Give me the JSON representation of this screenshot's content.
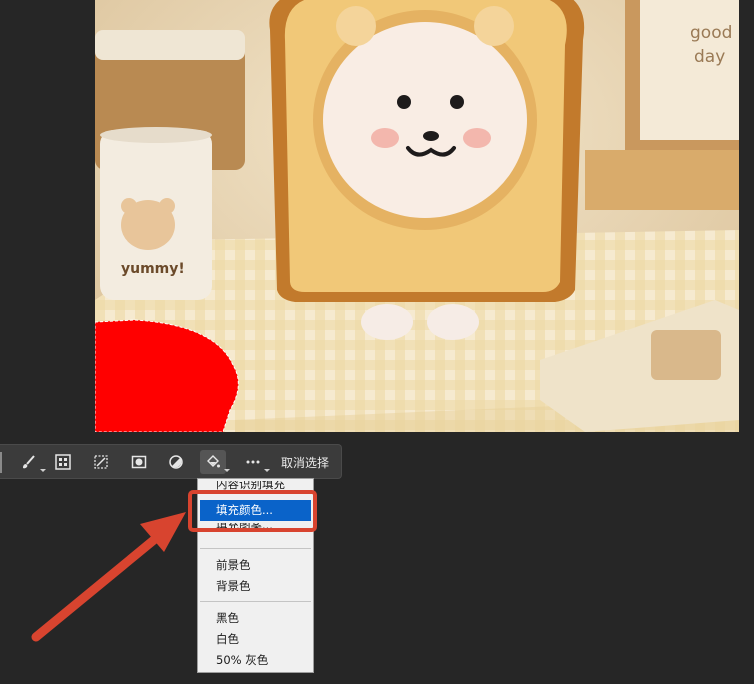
{
  "canvas": {
    "photo_text_mug": "yummy!",
    "photo_text_card_line1": "good",
    "photo_text_card_line2": "day"
  },
  "taskbar": {
    "buttons": [
      {
        "name": "brush-selection-tool",
        "icon": "brush-icon"
      },
      {
        "name": "select-subject",
        "icon": "checker-grid-icon"
      },
      {
        "name": "transform-selection",
        "icon": "transform-icon"
      },
      {
        "name": "create-mask",
        "icon": "mask-icon"
      },
      {
        "name": "adjustment-layer",
        "icon": "half-circle-icon"
      },
      {
        "name": "fill-selection",
        "icon": "paint-bucket-icon"
      },
      {
        "name": "more-options",
        "icon": "more-icon"
      }
    ],
    "deselect_label": "取消选择"
  },
  "fill_menu": {
    "items": [
      {
        "label": "内容识别填充",
        "state": "clipped"
      },
      {
        "label": "填充颜色...",
        "state": "highlighted"
      },
      {
        "label": "填充图案...",
        "state": "clipped"
      },
      {
        "label": "前景色"
      },
      {
        "label": "背景色"
      },
      {
        "label": "黑色"
      },
      {
        "label": "白色"
      },
      {
        "label": "50% 灰色"
      }
    ]
  },
  "colors": {
    "selection_fill": "#ff0000",
    "highlight": "#0a63c9",
    "callout": "#d8442f"
  }
}
